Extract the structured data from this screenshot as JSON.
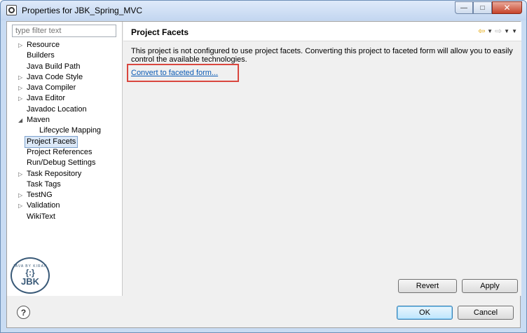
{
  "window": {
    "title": "Properties for JBK_Spring_MVC",
    "minimize_glyph": "—",
    "maximize_glyph": "□",
    "close_glyph": "✕"
  },
  "filter": {
    "placeholder": "type filter text"
  },
  "tree": [
    {
      "label": "Resource",
      "arrow": "▷",
      "indent": 0
    },
    {
      "label": "Builders",
      "arrow": "",
      "indent": 0
    },
    {
      "label": "Java Build Path",
      "arrow": "",
      "indent": 0
    },
    {
      "label": "Java Code Style",
      "arrow": "▷",
      "indent": 0
    },
    {
      "label": "Java Compiler",
      "arrow": "▷",
      "indent": 0
    },
    {
      "label": "Java Editor",
      "arrow": "▷",
      "indent": 0
    },
    {
      "label": "Javadoc Location",
      "arrow": "",
      "indent": 0
    },
    {
      "label": "Maven",
      "arrow": "◢",
      "indent": 0
    },
    {
      "label": "Lifecycle Mapping",
      "arrow": "",
      "indent": 1
    },
    {
      "label": "Project Facets",
      "arrow": "",
      "indent": 0,
      "selected": true
    },
    {
      "label": "Project References",
      "arrow": "",
      "indent": 0
    },
    {
      "label": "Run/Debug Settings",
      "arrow": "",
      "indent": 0
    },
    {
      "label": "Task Repository",
      "arrow": "▷",
      "indent": 0
    },
    {
      "label": "Task Tags",
      "arrow": "",
      "indent": 0
    },
    {
      "label": "TestNG",
      "arrow": "▷",
      "indent": 0
    },
    {
      "label": "Validation",
      "arrow": "▷",
      "indent": 0
    },
    {
      "label": "WikiText",
      "arrow": "",
      "indent": 0
    }
  ],
  "logo": {
    "ring_text": "JAVA BY KIRAN",
    "braces": "{:}",
    "text": "JBK"
  },
  "page": {
    "title": "Project Facets",
    "description": "This project is not configured to use project facets. Converting this project to faceted form will allow you to easily control the available technologies.",
    "convert_link": "Convert to faceted form..."
  },
  "nav": {
    "back_glyph": "⇦",
    "forward_glyph": "⇨",
    "dropdown_glyph": "▼",
    "menu_glyph": "▼"
  },
  "buttons": {
    "revert": "Revert",
    "apply": "Apply",
    "ok": "OK",
    "cancel": "Cancel",
    "help": "?"
  },
  "colors": {
    "highlight_box": "#d9473f",
    "link": "#0b5bb5",
    "selection": "#dbe8f7"
  }
}
